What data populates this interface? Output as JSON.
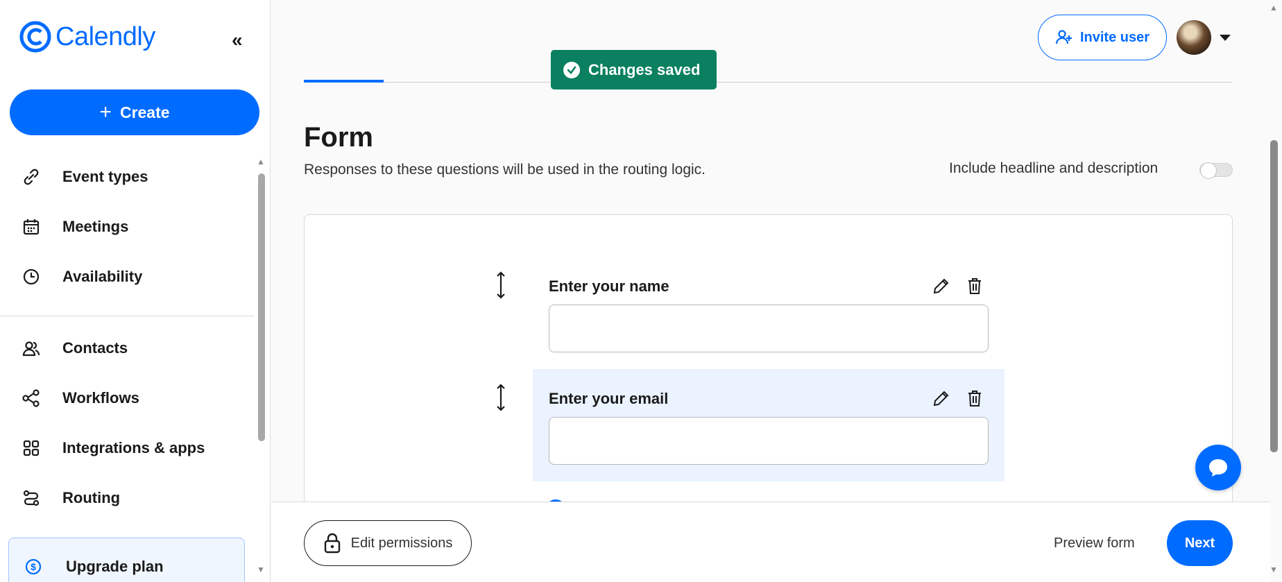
{
  "app": {
    "brand": "Calendly",
    "collapse_glyph": "«",
    "accent_color": "#006bff",
    "toast_color": "#0a8060"
  },
  "sidebar": {
    "create_label": "Create",
    "items": [
      {
        "label": "Event types",
        "icon": "link-icon"
      },
      {
        "label": "Meetings",
        "icon": "calendar-icon"
      },
      {
        "label": "Availability",
        "icon": "clock-icon"
      },
      {
        "label": "Contacts",
        "icon": "contacts-icon"
      },
      {
        "label": "Workflows",
        "icon": "workflow-icon"
      },
      {
        "label": "Integrations & apps",
        "icon": "grid-icon"
      },
      {
        "label": "Routing",
        "icon": "routing-icon"
      }
    ],
    "upgrade_label": "Upgrade plan"
  },
  "header": {
    "toast": "Changes saved",
    "invite_label": "Invite user"
  },
  "form": {
    "title": "Form",
    "description": "Responses to these questions will be used in the routing logic.",
    "toggle_label": "Include headline and description",
    "toggle_on": false,
    "questions": [
      {
        "label": "Enter your name",
        "value": ""
      },
      {
        "label": "Enter your email",
        "value": ""
      }
    ]
  },
  "footer": {
    "edit_permissions_label": "Edit permissions",
    "preview_label": "Preview form",
    "next_label": "Next"
  }
}
